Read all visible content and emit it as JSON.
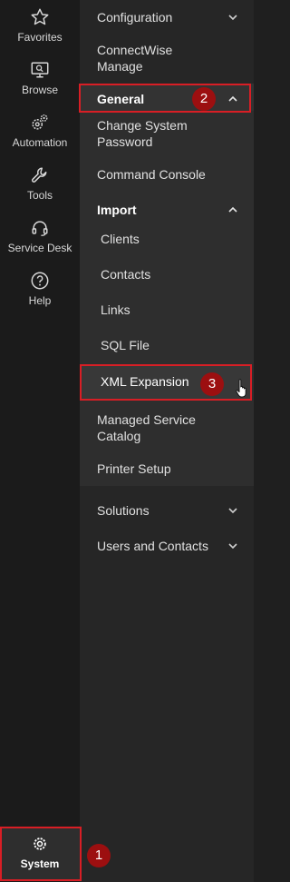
{
  "rail": {
    "items": [
      {
        "label": "Favorites",
        "icon": "star-icon"
      },
      {
        "label": "Browse",
        "icon": "monitor-search-icon"
      },
      {
        "label": "Automation",
        "icon": "gears-icon"
      },
      {
        "label": "Tools",
        "icon": "wrench-icon"
      },
      {
        "label": "Service Desk",
        "icon": "headset-icon"
      },
      {
        "label": "Help",
        "icon": "help-icon"
      }
    ],
    "system": {
      "label": "System",
      "icon": "gear-icon"
    }
  },
  "menu": {
    "configuration": "Configuration",
    "connectwise_manage": "ConnectWise Manage",
    "general": "General",
    "change_system_password": "Change System Password",
    "command_console": "Command Console",
    "import": "Import",
    "import_items": [
      "Clients",
      "Contacts",
      "Links",
      "SQL File"
    ],
    "xml_expansion": "XML Expansion",
    "managed_service_catalog": "Managed Service Catalog",
    "printer_setup": "Printer Setup",
    "solutions": "Solutions",
    "users_and_contacts": "Users and Contacts"
  },
  "callouts": [
    "1",
    "2",
    "3"
  ],
  "colors": {
    "highlight": "#d81e25",
    "badge": "#9c0f10",
    "rail": "#1b1b1b",
    "panel": "#262626"
  }
}
